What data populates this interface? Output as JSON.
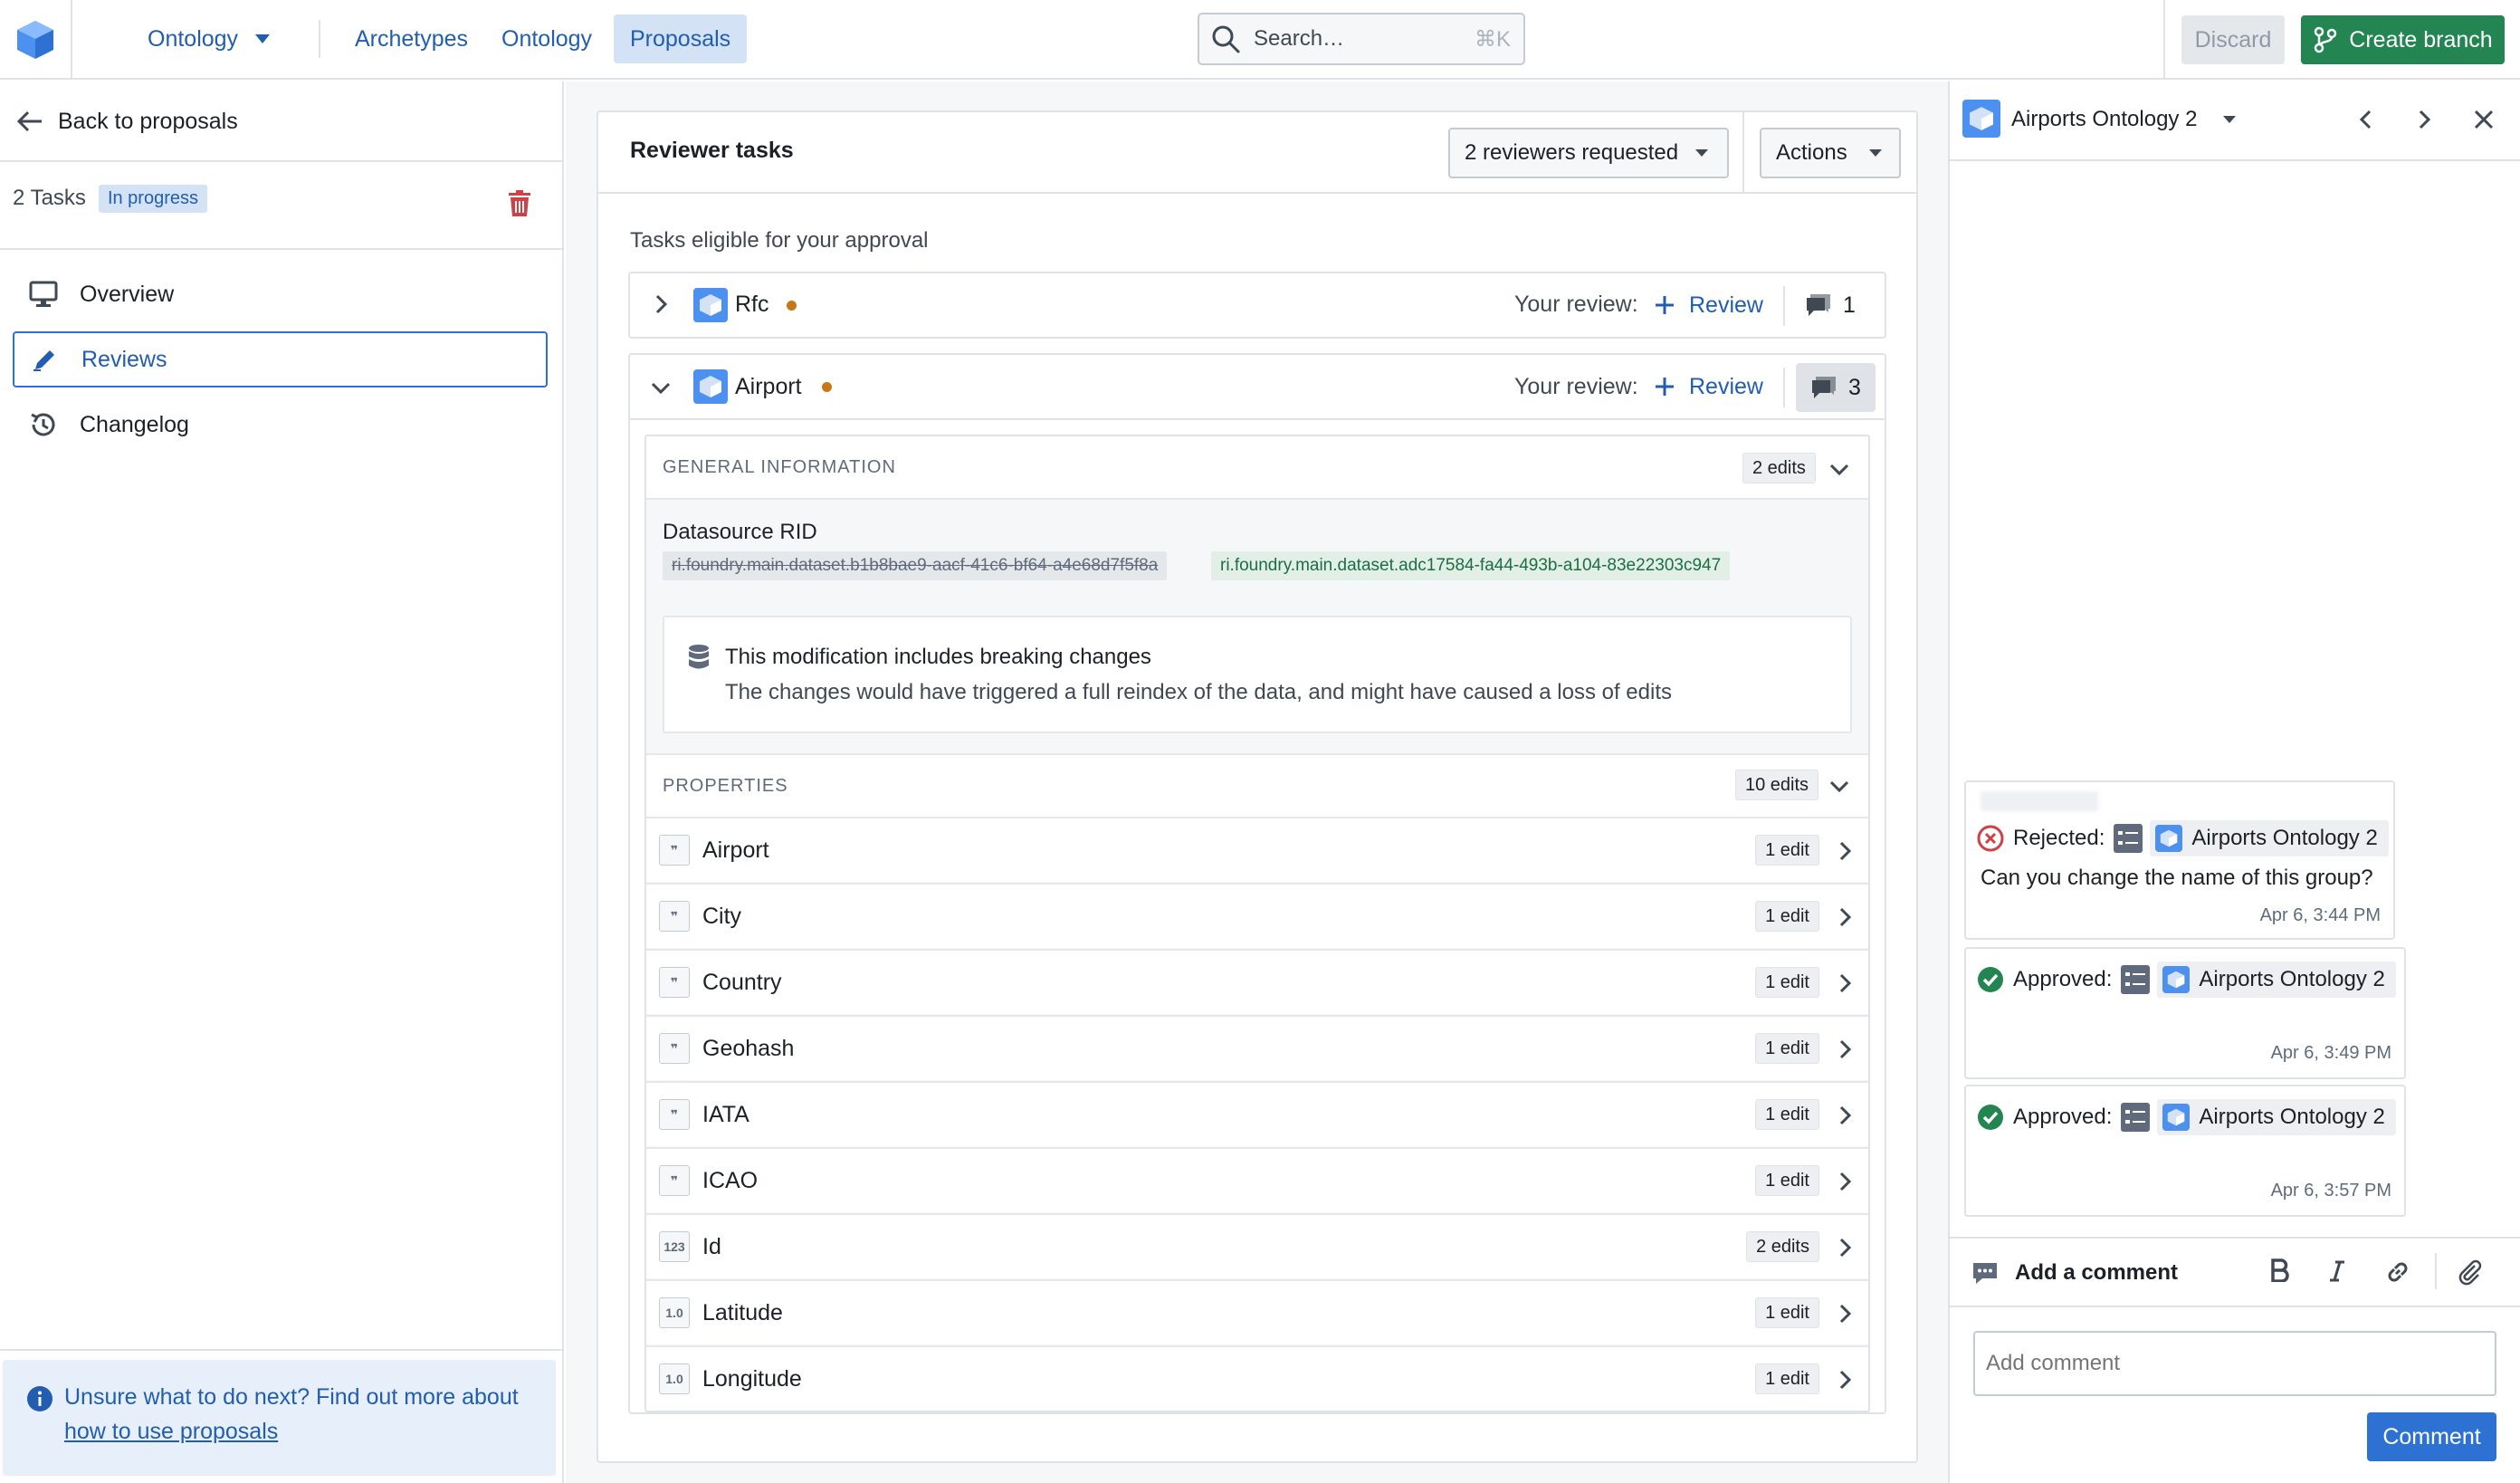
{
  "topbar": {
    "app_menu_label": "Ontology",
    "nav": [
      "Archetypes",
      "Ontology",
      "Proposals"
    ],
    "active_nav": "Proposals",
    "search_placeholder": "Search…",
    "search_shortcut": "⌘K",
    "discard_label": "Discard",
    "create_branch_label": "Create branch"
  },
  "left": {
    "back_label": "Back to proposals",
    "tasks_count": "2 Tasks",
    "status_tag": "In progress",
    "nav": [
      {
        "label": "Overview",
        "icon": "desktop-icon"
      },
      {
        "label": "Reviews",
        "icon": "pencil-icon"
      },
      {
        "label": "Changelog",
        "icon": "history-icon"
      }
    ],
    "active_nav": "Reviews",
    "help_text": "Unsure what to do next? Find out more about",
    "help_link": "how to use proposals"
  },
  "center": {
    "title": "Reviewer tasks",
    "reviewers_select": "2 reviewers requested",
    "actions_label": "Actions",
    "eligible_label": "Tasks eligible for your approval",
    "tasks": [
      {
        "name": "Rfc",
        "your_review": "Your review:",
        "review_label": "Review",
        "comment_count": "1",
        "expanded": false
      },
      {
        "name": "Airport",
        "your_review": "Your review:",
        "review_label": "Review",
        "comment_count": "3",
        "expanded": true
      }
    ],
    "general": {
      "header": "GENERAL INFORMATION",
      "edits": "2 edits",
      "field_label": "Datasource RID",
      "old_value": "ri.foundry.main.dataset.b1b8bae9-aacf-41c6-bf64-a4e68d7f5f8a",
      "new_value": "ri.foundry.main.dataset.adc17584-fa44-493b-a104-83e22303c947",
      "callout_title": "This modification includes breaking changes",
      "callout_text": "The changes would have triggered a full reindex of the data, and might have caused a loss of edits"
    },
    "properties": {
      "header": "PROPERTIES",
      "edits": "10 edits",
      "rows": [
        {
          "type_icon": "❞",
          "name": "Airport",
          "edits": "1 edit"
        },
        {
          "type_icon": "❞",
          "name": "City",
          "edits": "1 edit"
        },
        {
          "type_icon": "❞",
          "name": "Country",
          "edits": "1 edit"
        },
        {
          "type_icon": "❞",
          "name": "Geohash",
          "edits": "1 edit"
        },
        {
          "type_icon": "❞",
          "name": "IATA",
          "edits": "1 edit"
        },
        {
          "type_icon": "❞",
          "name": "ICAO",
          "edits": "1 edit"
        },
        {
          "type_icon": "123",
          "name": "Id",
          "edits": "2 edits"
        },
        {
          "type_icon": "1.0",
          "name": "Latitude",
          "edits": "1 edit"
        },
        {
          "type_icon": "1.0",
          "name": "Longitude",
          "edits": "1 edit"
        }
      ]
    }
  },
  "right": {
    "title": "Airports Ontology 2",
    "comments": [
      {
        "status": "Rejected:",
        "target": "Airports Ontology 2",
        "text": "Can you change the name of this group?",
        "time": "Apr 6, 3:44 PM",
        "status_color": "#cd4246"
      },
      {
        "status": "Approved:",
        "target": "Airports Ontology 2",
        "text": "",
        "time": "Apr 6, 3:49 PM",
        "status_color": "#238551"
      },
      {
        "status": "Approved:",
        "target": "Airports Ontology 2",
        "text": "",
        "time": "Apr 6, 3:57 PM",
        "status_color": "#238551"
      }
    ],
    "add_comment_label": "Add a comment",
    "comment_placeholder": "Add comment",
    "comment_button": "Comment"
  },
  "colors": {
    "primary": "#2d72d2",
    "link": "#215db0",
    "success": "#238551",
    "danger": "#cd4246",
    "warning_dot": "#c87619"
  }
}
